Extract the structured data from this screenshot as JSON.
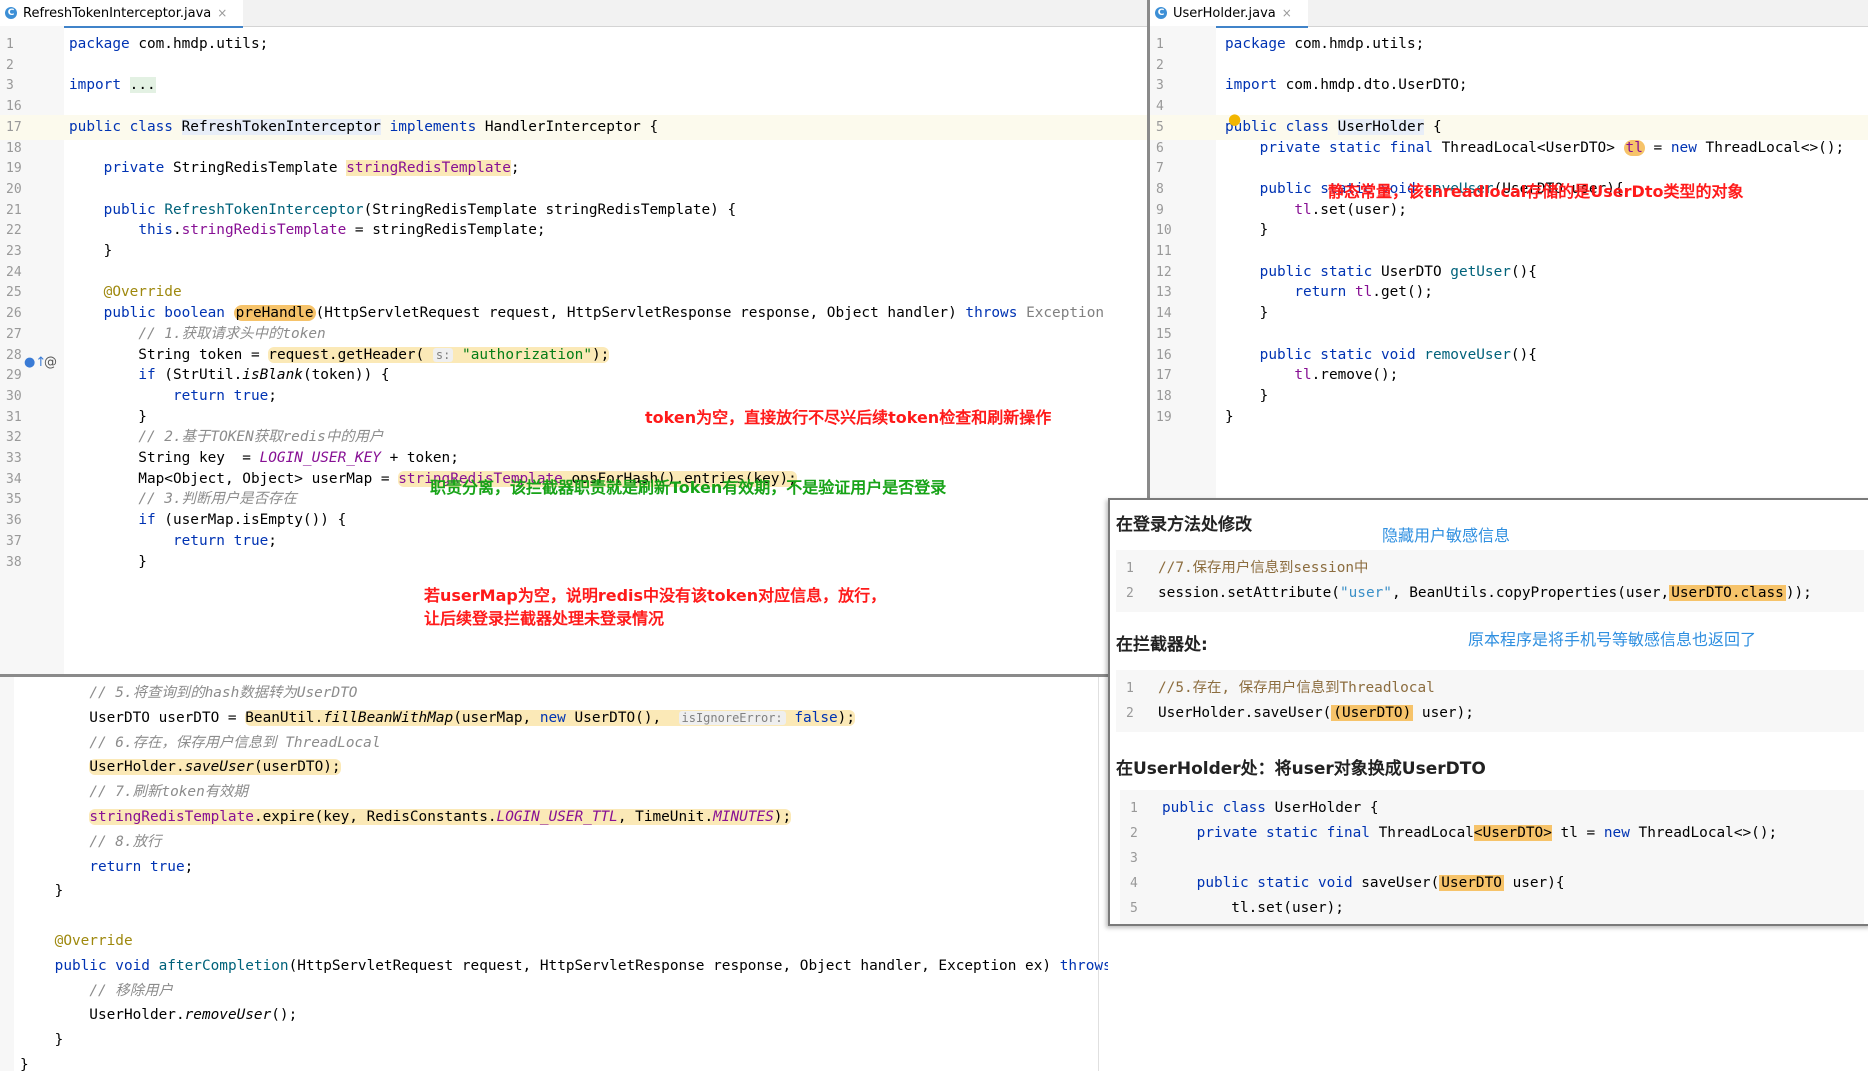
{
  "left_editor": {
    "tab": {
      "icon": "C",
      "label": "RefreshTokenInterceptor.java",
      "close": "×"
    },
    "lines": [
      {
        "n": "1",
        "html": "<span class='kw'>package</span> com.hmdp.utils;"
      },
      {
        "n": "2",
        "html": ""
      },
      {
        "n": "3",
        "html": "<span class='kw'>import</span> <span style='background:#e3f1e3'>...</span>"
      },
      {
        "n": "16",
        "html": ""
      },
      {
        "n": "17",
        "html": "<span class='kw'>public class</span> <span style='background:#e8eef8'>RefreshTokenInterceptor</span> <span class='kw'>implements</span> HandlerInterceptor {"
      },
      {
        "n": "18",
        "html": ""
      },
      {
        "n": "19",
        "html": "    <span class='kw'>private</span> StringRedisTemplate <span class='fld' style='background:#fbe9b7'>stringRedisTemplate</span>;"
      },
      {
        "n": "20",
        "html": ""
      },
      {
        "n": "21",
        "html": "    <span class='kw'>public</span> <span class='fn'>RefreshTokenInterceptor</span>(StringRedisTemplate stringRedisTemplate) {"
      },
      {
        "n": "22",
        "html": "        <span class='kw'>this</span>.<span class='fld'>stringRedisTemplate</span> = stringRedisTemplate;"
      },
      {
        "n": "23",
        "html": "    }"
      },
      {
        "n": "24",
        "html": ""
      },
      {
        "n": "25",
        "html": "    <span class='an'>@Override</span>"
      },
      {
        "n": "26",
        "html": "    <span class='kw'>public boolean</span> <span class='hlo'>preHandle</span>(HttpServletRequest request, HttpServletResponse response, Object handler) <span class='kw'>throws</span> <span style='color:#808080'>Exception</span>"
      },
      {
        "n": "27",
        "html": "        <span class='cm'>// 1.获取请求头中的token</span>"
      },
      {
        "n": "28",
        "html": "        String token = <span class='hl'>request.getHeader( <span class='hint'>s:</span> <span class='st'>\"authorization\"</span>);</span>"
      },
      {
        "n": "29",
        "html": "        <span class='kw'>if</span> (StrUtil.<span class='it'>isBlank</span>(token)) {"
      },
      {
        "n": "30",
        "html": "            <span class='kw'>return true</span>;"
      },
      {
        "n": "31",
        "html": "        }"
      },
      {
        "n": "32",
        "html": "        <span class='cm'>// 2.基于TOKEN获取redis中的用户</span>"
      },
      {
        "n": "33",
        "html": "        String key  = <span class='const'>LOGIN_USER_KEY</span> + token;"
      },
      {
        "n": "34",
        "html": "        Map&lt;Object, Object&gt; userMap = <span class='hl'><span class='fld'>stringRedisTemplate</span>.opsForHash().entries(key);</span>"
      },
      {
        "n": "35",
        "html": "        <span class='cm'>// 3.判断用户是否存在</span>"
      },
      {
        "n": "36",
        "html": "        <span class='kw'>if</span> (userMap.isEmpty()) {"
      },
      {
        "n": "37",
        "html": "            <span class='kw'>return true</span>;"
      },
      {
        "n": "38",
        "html": "        }"
      }
    ]
  },
  "right_editor": {
    "tab": {
      "icon": "C",
      "label": "UserHolder.java",
      "close": "×"
    },
    "lines": [
      {
        "n": "1",
        "html": "<span class='kw'>package</span> com.hmdp.utils;"
      },
      {
        "n": "2",
        "html": ""
      },
      {
        "n": "3",
        "html": "<span class='kw'>import</span> com.hmdp.dto.UserDTO;"
      },
      {
        "n": "4",
        "html": ""
      },
      {
        "n": "5",
        "html": "<span class='kw'>public class</span> <span style='background:#e8eef8'>UserHolder</span> {"
      },
      {
        "n": "6",
        "html": "    <span class='kw'>private static final</span> ThreadLocal&lt;UserDTO&gt; <span class='hlo fld'>tl</span> = <span class='kw'>new</span> ThreadLocal&lt;&gt;();"
      },
      {
        "n": "7",
        "html": ""
      },
      {
        "n": "8",
        "html": "    <span class='kw'>public static void</span> <span class='fn'>saveUser</span>(UserDTO user){"
      },
      {
        "n": "9",
        "html": "        <span class='fld'>tl</span>.set(user);"
      },
      {
        "n": "10",
        "html": "    }"
      },
      {
        "n": "11",
        "html": ""
      },
      {
        "n": "12",
        "html": "    <span class='kw'>public static</span> UserDTO <span class='fn'>getUser</span>(){"
      },
      {
        "n": "13",
        "html": "        <span class='kw'>return</span> <span class='fld'>tl</span>.get();"
      },
      {
        "n": "14",
        "html": "    }"
      },
      {
        "n": "15",
        "html": ""
      },
      {
        "n": "16",
        "html": "    <span class='kw'>public static void</span> <span class='fn'>removeUser</span>(){"
      },
      {
        "n": "17",
        "html": "        <span class='fld'>tl</span>.remove();"
      },
      {
        "n": "18",
        "html": "    }"
      },
      {
        "n": "19",
        "html": "}"
      }
    ]
  },
  "bottom_editor": {
    "lines": [
      {
        "html": "        <span class='cm'>// 5.将查询到的hash数据转为UserDTO</span>"
      },
      {
        "html": "        UserDTO userDTO = <span class='hl'>BeanUtil.<span class='it'>fillBeanWithMap</span>(userMap, <span class='kw'>new</span> UserDTO(),  <span class='hint'>isIgnoreError:</span> <span class='kw'>false</span>);</span>"
      },
      {
        "html": "        <span class='cm'>// 6.存在，保存用户信息到 ThreadLocal</span>"
      },
      {
        "html": "        <span class='hl'>UserHolder.<span class='it'>saveUser</span>(userDTO);</span>"
      },
      {
        "html": "        <span class='cm'>// 7.刷新token有效期</span>"
      },
      {
        "html": "        <span class='hl'><span class='fld'>stringRedisTemplate</span>.expire(key, RedisConstants.<span class='const'>LOGIN_USER_TTL</span>, TimeUnit.<span class='const'>MINUTES</span>);</span>"
      },
      {
        "html": "        <span class='cm'>// 8.放行</span>"
      },
      {
        "html": "        <span class='kw'>return true</span>;"
      },
      {
        "html": "    }"
      },
      {
        "html": ""
      },
      {
        "html": "    <span class='an'>@Override</span>"
      },
      {
        "html": "    <span class='kw'>public void</span> <span class='fn'>afterCompletion</span>(HttpServletRequest request, HttpServletResponse response, Object handler, Exception ex) <span class='kw'>throws</span> <span style='color:#808080'>Exception</span> {"
      },
      {
        "html": "        <span class='cm'>// 移除用户</span>"
      },
      {
        "html": "        UserHolder.<span class='it'>removeUser</span>();"
      },
      {
        "html": "    }"
      },
      {
        "html": "}"
      }
    ]
  },
  "annotations": {
    "token_empty": "token为空，直接放行不尽兴后续token检查和刷新操作",
    "separation": "职责分离，该拦截器职责就是刷新Token有效期，不是验证用户是否登录",
    "usermap_empty_1": "若userMap为空，说明redis中没有该token对应信息，放行，",
    "usermap_empty_2": "让后续登录拦截器处理未登录情况",
    "static_const": "静态常量，该threadlocal存储的是UserDto类型的对象"
  },
  "doc_panel": {
    "heading1": "在登录方法处修改",
    "hint1": "隐藏用户敏感信息",
    "snippet1": [
      {
        "n": "1",
        "html": "<span style='color:#8c6d3f'>//7.保存用户信息到session中</span>"
      },
      {
        "n": "2",
        "html": "session.setAttribute(<span class='st' style='color:#3a8fc7'>\"user\"</span>, BeanUtils.copyProperties(user,<span style='background:#f6c36a;padding:0 2px'>UserDTO.class</span>));"
      }
    ],
    "heading2": "在拦截器处:",
    "hint2": "原本程序是将手机号等敏感信息也返回了",
    "snippet2": [
      {
        "n": "1",
        "html": "<span style='color:#8c6d3f'>//5.存在, 保存用户信息到Threadlocal</span>"
      },
      {
        "n": "2",
        "html": "UserHolder.saveUser(<span style='background:#f6c36a;padding:0 2px'>(UserDTO)</span> user);"
      }
    ],
    "heading3": "在UserHolder处：将user对象换成UserDTO",
    "snippet3": [
      {
        "n": "1",
        "html": "<span class='kw'>public class</span> UserHolder {"
      },
      {
        "n": "2",
        "html": "    <span class='kw'>private static final</span> ThreadLocal<span style='background:#f6c36a'>&lt;UserDTO&gt;</span> tl = <span class='kw'>new</span> ThreadLocal&lt;&gt;();"
      },
      {
        "n": "3",
        "html": ""
      },
      {
        "n": "4",
        "html": "    <span class='kw'>public static void</span> saveUser(<span style='background:#f6c36a;padding:0 2px'>UserDTO</span> user){"
      },
      {
        "n": "5",
        "html": "        tl.set(user);"
      }
    ]
  },
  "colors": {
    "accent": "#4083c9",
    "keyword": "#0033b3",
    "red_note": "#ff1a1a",
    "green_note": "#17a317",
    "blue_note": "#2f8fe0"
  }
}
